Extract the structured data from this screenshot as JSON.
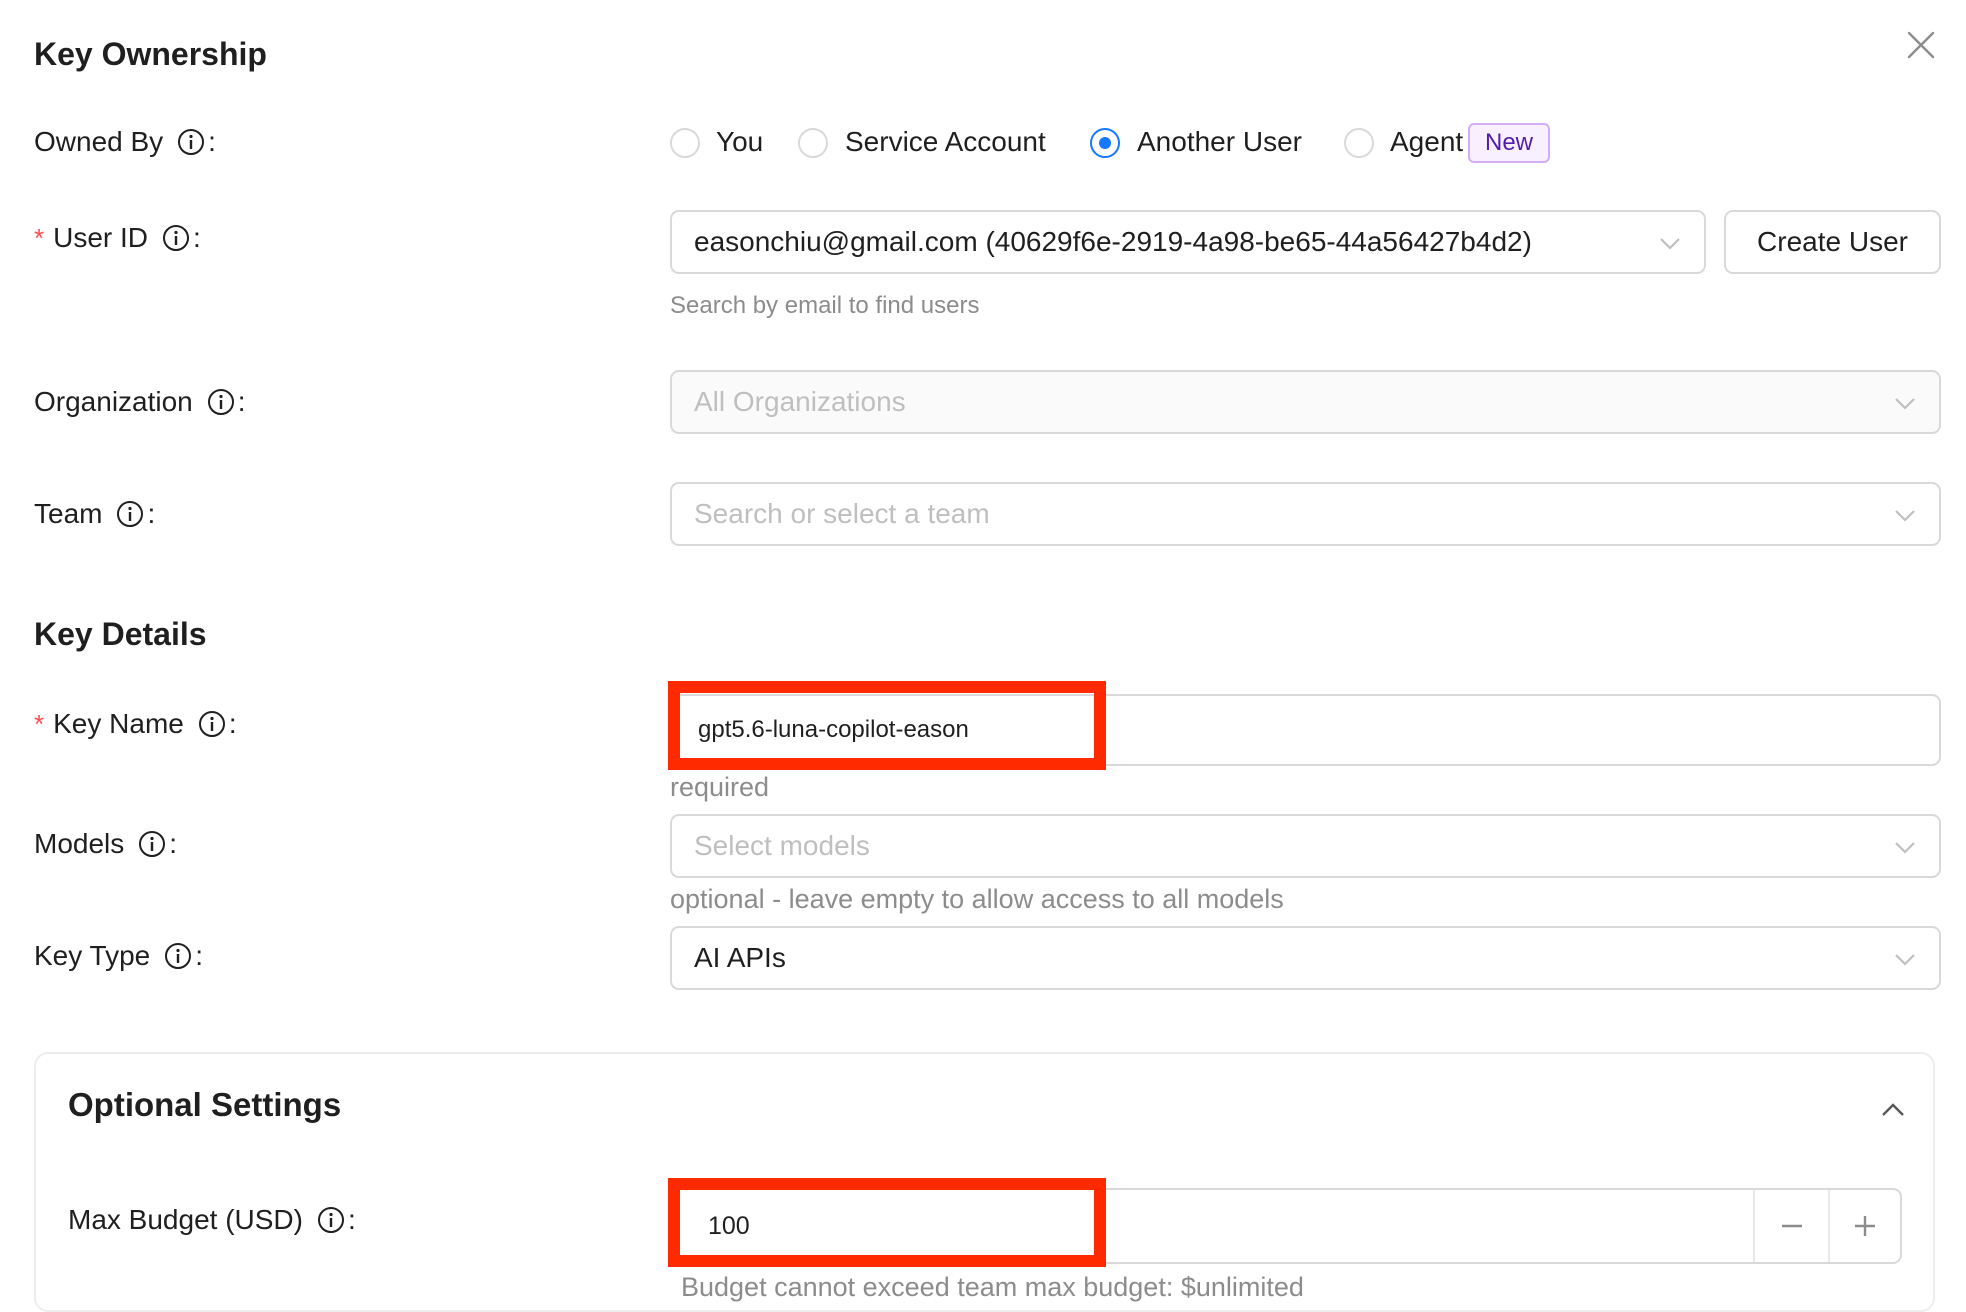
{
  "modal": {
    "close_icon": "close-icon"
  },
  "ownership": {
    "title": "Key Ownership",
    "owned_by": {
      "label": "Owned By",
      "options": [
        "You",
        "Service Account",
        "Another User",
        "Agent"
      ],
      "selected": "Another User",
      "agent_tag": "New"
    },
    "user_id": {
      "label": "User ID",
      "value": "easonchiu@gmail.com (40629f6e-2919-4a98-be65-44a56427b4d2)",
      "help": "Search by email to find users",
      "create_button": "Create User"
    },
    "organization": {
      "label": "Organization",
      "placeholder": "All Organizations"
    },
    "team": {
      "label": "Team",
      "placeholder": "Search or select a team"
    }
  },
  "details": {
    "title": "Key Details",
    "key_name": {
      "label": "Key Name",
      "value": "gpt5.6-luna-copilot-eason",
      "help": "required"
    },
    "models": {
      "label": "Models",
      "placeholder": "Select models",
      "help": "optional - leave empty to allow access to all models"
    },
    "key_type": {
      "label": "Key Type",
      "value": "AI APIs"
    }
  },
  "optional": {
    "title": "Optional Settings",
    "max_budget": {
      "label": "Max Budget (USD)",
      "value": "100",
      "help": "Budget cannot exceed team max budget: $unlimited"
    }
  },
  "colors": {
    "accent": "#1677ff",
    "required": "#ff4d4f",
    "highlight": "#ff2a00",
    "tag_bg": "#f9f0ff",
    "tag_text": "#531dab"
  }
}
